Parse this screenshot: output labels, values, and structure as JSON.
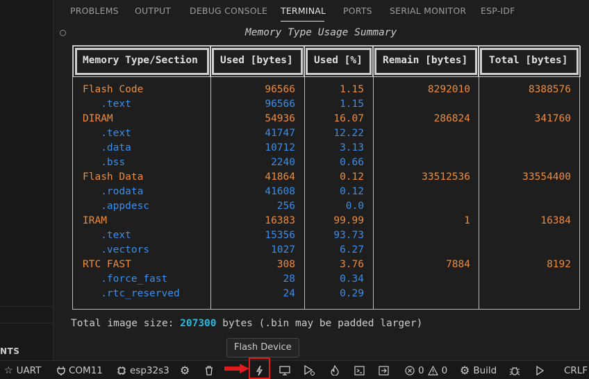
{
  "sidebar": {
    "label": "NTS"
  },
  "tabs": [
    {
      "label": "PROBLEMS",
      "active": false
    },
    {
      "label": "OUTPUT",
      "active": false
    },
    {
      "label": "DEBUG CONSOLE",
      "active": false
    },
    {
      "label": "TERMINAL",
      "active": true
    },
    {
      "label": "PORTS",
      "active": false
    },
    {
      "label": "SERIAL MONITOR",
      "active": false
    },
    {
      "label": "ESP-IDF",
      "active": false
    }
  ],
  "terminal": {
    "title": "Memory Type Usage Summary",
    "headers": [
      "Memory Type/Section",
      "Used [bytes]",
      "Used [%]",
      "Remain [bytes]",
      "Total [bytes]"
    ],
    "rows": [
      {
        "name": "Flash Code",
        "used": "96566",
        "pct": "1.15",
        "remain": "8292010",
        "total": "8388576",
        "kind": "type"
      },
      {
        "name": "   .text",
        "used": "96566",
        "pct": "1.15",
        "remain": "",
        "total": "",
        "kind": "section"
      },
      {
        "name": "DIRAM",
        "used": "54936",
        "pct": "16.07",
        "remain": "286824",
        "total": "341760",
        "kind": "type"
      },
      {
        "name": "   .text",
        "used": "41747",
        "pct": "12.22",
        "remain": "",
        "total": "",
        "kind": "section"
      },
      {
        "name": "   .data",
        "used": "10712",
        "pct": "3.13",
        "remain": "",
        "total": "",
        "kind": "section"
      },
      {
        "name": "   .bss",
        "used": "2240",
        "pct": "0.66",
        "remain": "",
        "total": "",
        "kind": "section"
      },
      {
        "name": "Flash Data",
        "used": "41864",
        "pct": "0.12",
        "remain": "33512536",
        "total": "33554400",
        "kind": "type"
      },
      {
        "name": "   .rodata",
        "used": "41608",
        "pct": "0.12",
        "remain": "",
        "total": "",
        "kind": "section"
      },
      {
        "name": "   .appdesc",
        "used": "256",
        "pct": "0.0",
        "remain": "",
        "total": "",
        "kind": "section"
      },
      {
        "name": "IRAM",
        "used": "16383",
        "pct": "99.99",
        "remain": "1",
        "total": "16384",
        "kind": "type"
      },
      {
        "name": "   .text",
        "used": "15356",
        "pct": "93.73",
        "remain": "",
        "total": "",
        "kind": "section"
      },
      {
        "name": "   .vectors",
        "used": "1027",
        "pct": "6.27",
        "remain": "",
        "total": "",
        "kind": "section"
      },
      {
        "name": "RTC FAST",
        "used": "308",
        "pct": "3.76",
        "remain": "7884",
        "total": "8192",
        "kind": "type"
      },
      {
        "name": "   .force_fast",
        "used": "28",
        "pct": "0.34",
        "remain": "",
        "total": "",
        "kind": "section"
      },
      {
        "name": "   .rtc_reserved",
        "used": "24",
        "pct": "0.29",
        "remain": "",
        "total": "",
        "kind": "section"
      }
    ],
    "total_prefix": "Total image size: ",
    "total_value": "207300",
    "total_suffix": " bytes (.bin may be padded larger)"
  },
  "tooltip": {
    "label": "Flash Device"
  },
  "statusbar": {
    "uart": "UART",
    "port": "COM11",
    "target": "esp32s3",
    "errors": "0",
    "warnings": "0",
    "build": "Build",
    "eol": "CRLF"
  },
  "colors": {
    "type_row": "#f08c36",
    "section_row": "#3b8eea",
    "highlight": "#29b8db",
    "flash_marker": "#e11b1b"
  }
}
